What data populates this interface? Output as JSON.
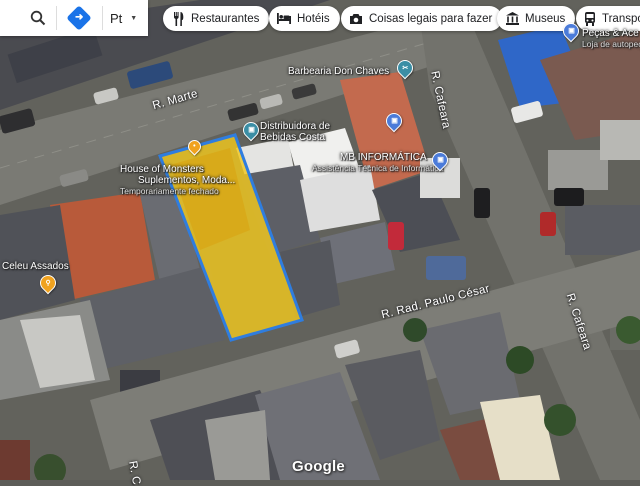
{
  "toolbar": {
    "lang_label": "Pt",
    "search_icon": "search-icon",
    "directions_icon": "directions-icon"
  },
  "chips": [
    {
      "label": "Restaurantes",
      "icon": "restaurant-icon"
    },
    {
      "label": "Hotéis",
      "icon": "hotel-icon"
    },
    {
      "label": "Coisas legais para fazer",
      "icon": "camera-icon"
    },
    {
      "label": "Museus",
      "icon": "museum-icon"
    },
    {
      "label": "Transpo",
      "icon": "transit-icon"
    }
  ],
  "streets": {
    "marte": "R. Marte",
    "cafeara_top": "R. Cafeara",
    "cafeara_bottom": "R. Cafeara",
    "paulo_cesar": "R. Rad. Paulo César",
    "bottom_left": "R. C"
  },
  "places": {
    "barbearia": "Barbearia Don Chaves",
    "distribuidora_1": "Distribuidora de",
    "distribuidora_2": "Bebidas Costa",
    "mb_1": "MB INFORMÁTICA",
    "mb_2": "Assistência Técnica de Informática",
    "house_1": "House of Monsters",
    "house_2": "Suplementos, Moda...",
    "house_3": "Temporariamente fechado",
    "celeu": "Celeu Assados",
    "pecas_1": "Peças & Ace",
    "pecas_2": "Loja de autopeç"
  },
  "branding": {
    "logo": "Google"
  },
  "colors": {
    "selection_outline": "#2f7ddf",
    "selection_fill": "#f2c81e",
    "pin_blue": "#4b7bd9",
    "pin_teal": "#3b8ea5",
    "pin_orange": "#f0a21f"
  }
}
